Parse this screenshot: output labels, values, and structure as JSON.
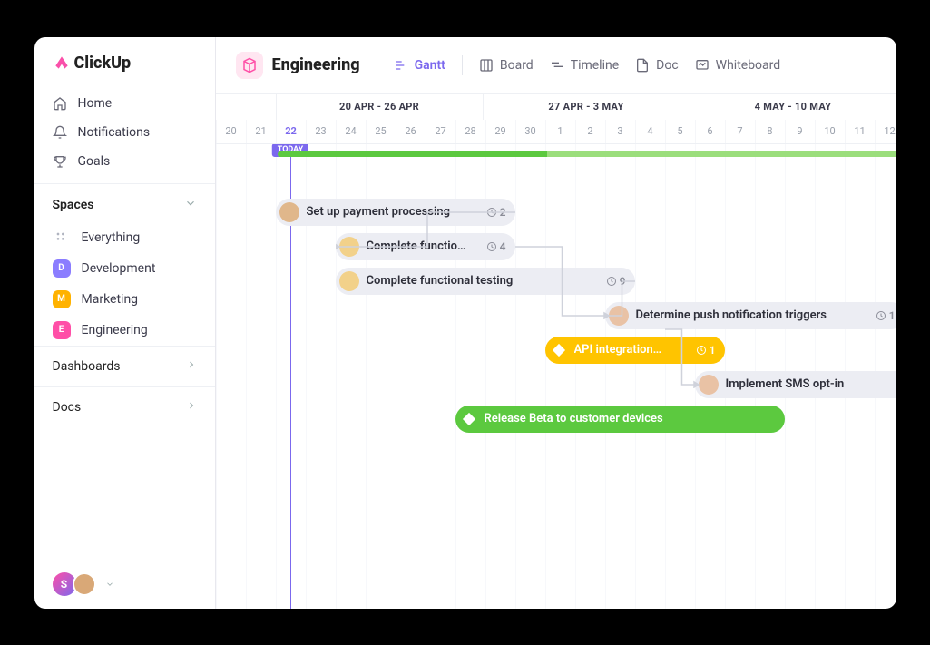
{
  "brand": "ClickUp",
  "nav": {
    "home": "Home",
    "notifications": "Notifications",
    "goals": "Goals"
  },
  "spaces_header": "Spaces",
  "spaces": {
    "everything": "Everything",
    "items": [
      {
        "letter": "D",
        "label": "Development",
        "color": "#8b7dff"
      },
      {
        "letter": "M",
        "label": "Marketing",
        "color": "#ffb200"
      },
      {
        "letter": "E",
        "label": "Engineering",
        "color": "#ff4fa7"
      }
    ]
  },
  "dashboards": "Dashboards",
  "docs": "Docs",
  "footer_user_letter": "S",
  "header": {
    "space_name": "Engineering",
    "views": {
      "gantt": "Gantt",
      "board": "Board",
      "timeline": "Timeline",
      "doc": "Doc",
      "whiteboard": "Whiteboard"
    }
  },
  "timeline": {
    "weeks": [
      "20 APR - 26 APR",
      "27 APR - 3 MAY",
      "4 MAY - 10 MAY"
    ],
    "lead_days": [
      "20",
      "21"
    ],
    "days": [
      "22",
      "23",
      "24",
      "25",
      "26",
      "27",
      "28",
      "29",
      "30",
      "1",
      "2",
      "3",
      "4",
      "5",
      "6",
      "7",
      "8",
      "9",
      "10",
      "11",
      "12"
    ],
    "today_label": "TODAY",
    "today_col": 2
  },
  "tasks": [
    {
      "label": "Set up payment processing",
      "count": "2",
      "start": 2,
      "span": 8,
      "row": 0,
      "avatar": "#e0b78b"
    },
    {
      "label": "Complete functio…",
      "count": "4",
      "start": 4,
      "span": 6,
      "row": 1,
      "avatar": "#f2d18a"
    },
    {
      "label": "Complete functional testing",
      "count": "9",
      "start": 4,
      "span": 10,
      "row": 2,
      "avatar": "#f2d18a"
    },
    {
      "label": "Determine push notification triggers",
      "count": "1",
      "start": 13,
      "span": 10,
      "row": 3,
      "avatar": "#e9c2a5"
    },
    {
      "label": "API integration…",
      "count": "1",
      "start": 11,
      "span": 6,
      "row": 4,
      "type": "milestone",
      "color": "yellow"
    },
    {
      "label": "Implement SMS opt-in",
      "count": "",
      "start": 16,
      "span": 9,
      "row": 5,
      "avatar": "#e9c2a5"
    },
    {
      "label": "Release Beta to customer devices",
      "count": "",
      "start": 8,
      "span": 11,
      "row": 6,
      "type": "milestone",
      "color": "green"
    }
  ],
  "colors": {
    "accent": "#7b68ee",
    "green_dark": "#5cc93f",
    "green_light": "#9bde7c",
    "yellow": "#ffc400",
    "pink": "#ff4fa7"
  }
}
